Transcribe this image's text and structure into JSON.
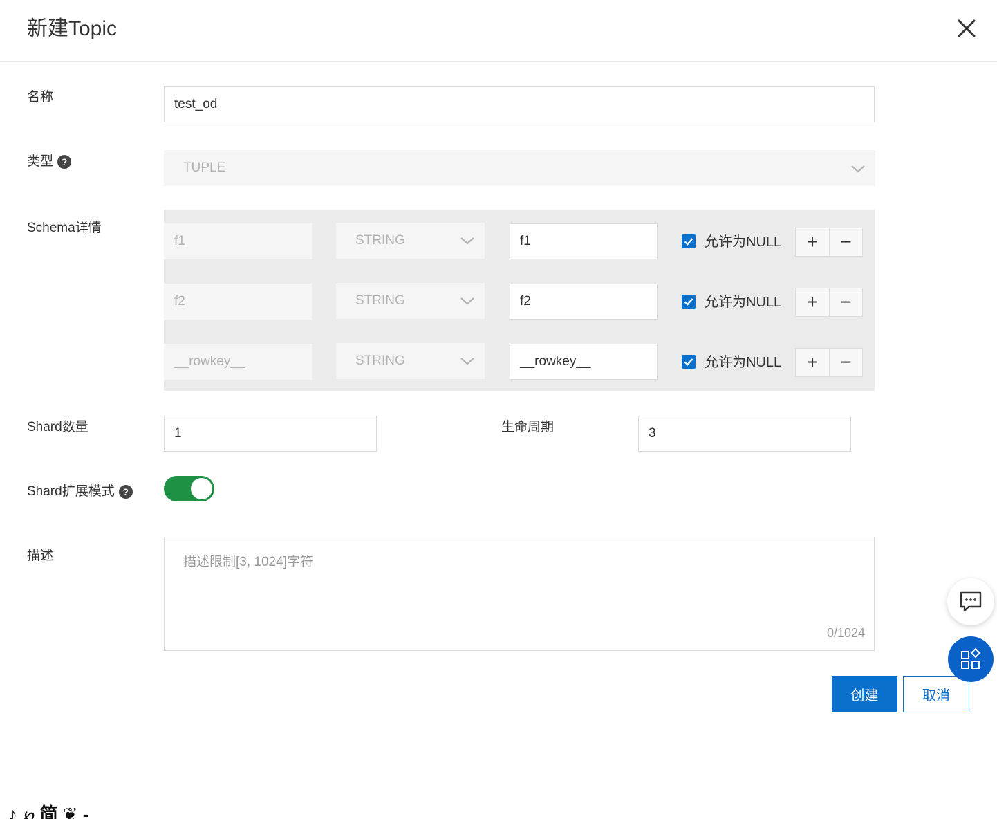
{
  "dialog": {
    "title": "新建Topic",
    "close_icon": "close-icon"
  },
  "form": {
    "name": {
      "label": "名称",
      "value": "test_od"
    },
    "type": {
      "label": "类型",
      "help": "?",
      "value": "TUPLE"
    },
    "schema": {
      "label": "Schema详情",
      "rows": [
        {
          "field": "f1",
          "type": "STRING",
          "comment": "f1",
          "allow_null_label": "允许为NULL",
          "allow_null": true,
          "add": "+",
          "remove": "−"
        },
        {
          "field": "f2",
          "type": "STRING",
          "comment": "f2",
          "allow_null_label": "允许为NULL",
          "allow_null": true,
          "add": "+",
          "remove": "−"
        },
        {
          "field": "__rowkey__",
          "type": "STRING",
          "comment": "__rowkey__",
          "allow_null_label": "允许为NULL",
          "allow_null": true,
          "add": "+",
          "remove": "−"
        }
      ]
    },
    "shard_count": {
      "label": "Shard数量",
      "value": "1"
    },
    "lifecycle": {
      "label": "生命周期",
      "value": "3"
    },
    "shard_extend": {
      "label": "Shard扩展模式",
      "help": "?",
      "enabled": true
    },
    "description": {
      "label": "描述",
      "placeholder": "描述限制[3, 1024]字符",
      "counter": "0/1024"
    }
  },
  "actions": {
    "create": "创建",
    "cancel": "取消"
  },
  "colors": {
    "primary": "#0a70cc",
    "toggle_on": "#1f9145"
  },
  "footer_fragment": "♪ ℘ 简 ❦ -"
}
